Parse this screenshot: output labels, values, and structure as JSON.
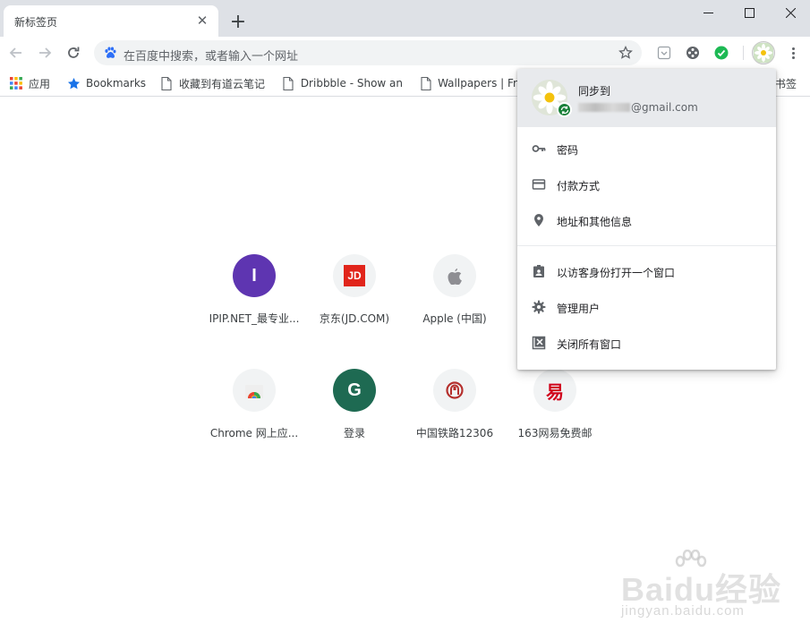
{
  "tab": {
    "title": "新标签页",
    "close": "✕"
  },
  "newtab": {
    "label": "+"
  },
  "window": {
    "minimize": "—",
    "maximize": "☐",
    "close": "✕"
  },
  "omnibox": {
    "placeholder": "在百度中搜索，或者输入一个网址"
  },
  "bookmarks": [
    {
      "label": "应用",
      "icon": "apps-grid-icon"
    },
    {
      "label": "Bookmarks",
      "icon": "star-icon"
    },
    {
      "label": "收藏到有道云笔记",
      "icon": "page-icon"
    },
    {
      "label": "Dribbble - Show an",
      "icon": "page-icon"
    },
    {
      "label": "Wallpapers | Fr",
      "icon": "page-icon"
    },
    {
      "label": "书签",
      "icon": "folder-icon"
    }
  ],
  "tiles": [
    {
      "label": "IPIP.NET_最专业...",
      "letter": "I",
      "color": "#5e35b1"
    },
    {
      "label": "京东(JD.COM)",
      "letter": "JD",
      "color": "#e1251b"
    },
    {
      "label": "Apple (中国)",
      "letter": "",
      "color": "#f1f3f4"
    },
    {
      "label": "Chrome 网上应...",
      "letter": "",
      "color": "#f1f3f4"
    },
    {
      "label": "登录",
      "letter": "G",
      "color": "#1e6a52"
    },
    {
      "label": "中国铁路12306",
      "letter": "",
      "color": "#f1f3f4"
    },
    {
      "label": "163网易免费邮",
      "letter": "易",
      "color": "#f1f3f4"
    }
  ],
  "profile_menu": {
    "sync_title": "同步到",
    "email_suffix": "@gmail.com",
    "items": [
      {
        "label": "密码",
        "icon": "key-icon"
      },
      {
        "label": "付款方式",
        "icon": "credit-card-icon"
      },
      {
        "label": "地址和其他信息",
        "icon": "location-pin-icon"
      },
      {
        "label": "以访客身份打开一个窗口",
        "icon": "guest-badge-icon"
      },
      {
        "label": "管理用户",
        "icon": "gear-icon"
      },
      {
        "label": "关闭所有窗口",
        "icon": "close-box-icon"
      }
    ]
  },
  "watermark": {
    "main": "Baidu经验",
    "sub": "jingyan.baidu.com"
  },
  "colors": {
    "accent_blue": "#1a73e8",
    "sync_green": "#188038",
    "frame": "#dee1e6"
  }
}
